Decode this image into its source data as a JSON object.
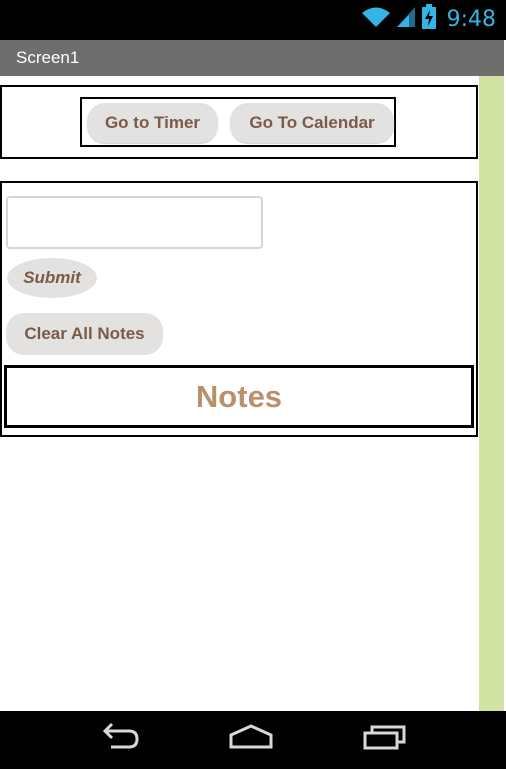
{
  "status_bar": {
    "time": "9:48",
    "icons": [
      "wifi-icon",
      "signal-icon",
      "battery-charging-icon"
    ],
    "accent_color": "#33b5e5"
  },
  "title_bar": {
    "title": "Screen1",
    "background": "#6e6e6e"
  },
  "nav_buttons": {
    "timer_label": "Go to Timer",
    "calendar_label": "Go To Calendar"
  },
  "notes_panel": {
    "input_value": "",
    "input_placeholder": "",
    "submit_label": "Submit",
    "clear_label": "Clear All Notes",
    "notes_title": "Notes",
    "notes_title_color": "#b8906a"
  },
  "android_nav": {
    "icons": [
      "back-icon",
      "home-icon",
      "recent-apps-icon"
    ]
  },
  "colors": {
    "button_bg": "#e4e2e0",
    "button_text": "#7a5a48",
    "side_strip": "#d2e2a2"
  }
}
